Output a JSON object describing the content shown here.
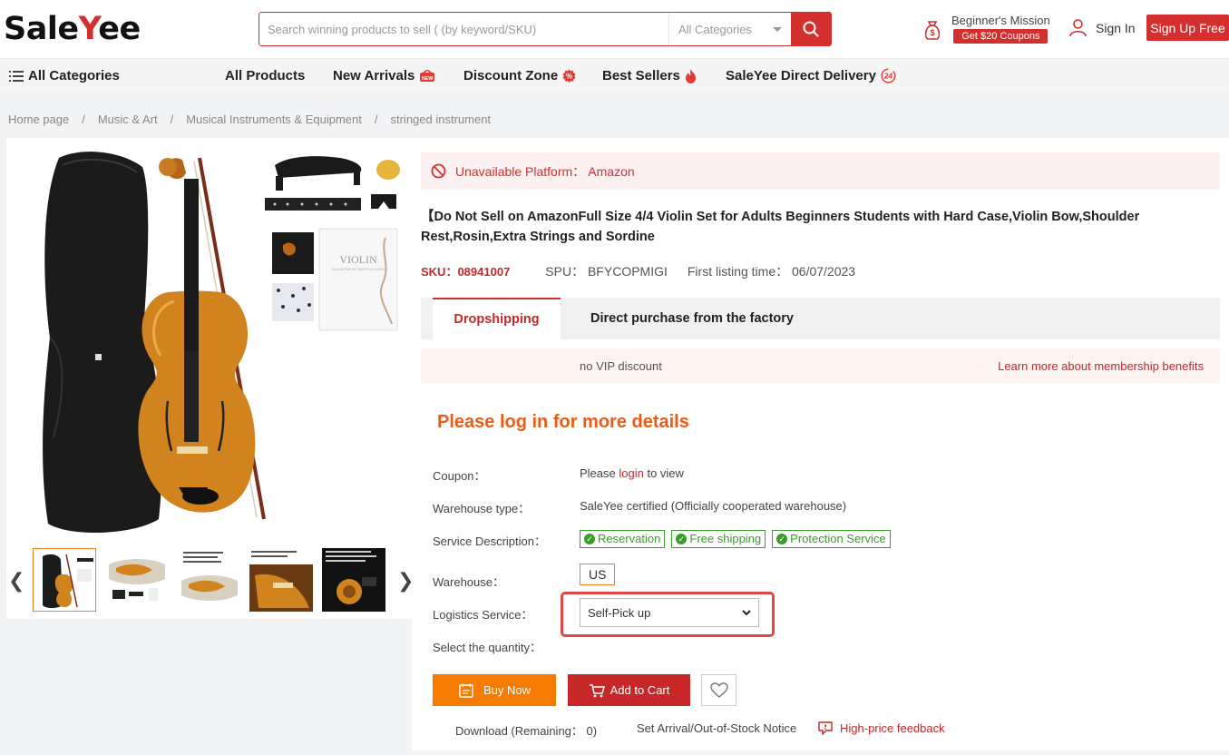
{
  "header": {
    "logo_prefix": "Sale",
    "logo_y": "Y",
    "logo_suffix": "ee",
    "search_placeholder": "Search winning products to sell ( (by keyword/SKU)",
    "category_select": "All Categories",
    "mission_title": "Beginner's Mission",
    "mission_coupon": "Get $20 Coupons",
    "sign_in": "Sign In",
    "sign_up": "Sign Up Free"
  },
  "nav": {
    "all_categories": "All Categories",
    "items": [
      {
        "label": "All Products"
      },
      {
        "label": "New Arrivals",
        "badge": "NEW"
      },
      {
        "label": "Discount Zone"
      },
      {
        "label": "Best Sellers"
      },
      {
        "label": "SaleYee Direct Delivery",
        "badge": "24"
      }
    ]
  },
  "breadcrumb": [
    "Home page",
    "Music & Art",
    "Musical Instruments & Equipment",
    "stringed instrument"
  ],
  "product": {
    "unavailable": "Unavailable Platform： Amazon",
    "title": "【Do Not Sell on AmazonFull Size 4/4 Violin Set for Adults Beginners Students with Hard Case,Violin Bow,Shoulder Rest,Rosin,Extra Strings and Sordine",
    "sku_label": "SKU：",
    "sku": "08941007",
    "spu": "SPU： BFYCOPMIGI",
    "first_listing": "First listing time： 06/07/2023",
    "manual_text": "VIOLIN",
    "manual_sub": "ADJUSTMENT INSTRUCTIONS"
  },
  "tabs": [
    {
      "label": "Dropshipping",
      "active": true
    },
    {
      "label": "Direct purchase from the factory",
      "active": false
    }
  ],
  "vip": {
    "label": "no VIP discount",
    "link": "Learn more about membership benefits"
  },
  "login_message": "Please log in for more details",
  "details": {
    "coupon_label": "Coupon：",
    "coupon_pre": "Please ",
    "coupon_link": "login",
    "coupon_post": " to view",
    "warehouse_type_label": "Warehouse type：",
    "warehouse_type": "SaleYee certified  (Officially cooperated warehouse)",
    "service_label": "Service Description：",
    "services": [
      "Reservation",
      "Free shipping",
      "Protection Service"
    ],
    "warehouse_label": "Warehouse：",
    "warehouse": "US",
    "logistics_label": "Logistics Service：",
    "logistics_value": "Self-Pick up",
    "quantity_label": "Select the quantity："
  },
  "actions": {
    "buy_now": "Buy Now",
    "add_to_cart": "Add to Cart",
    "download": "Download (Remaining： 0)",
    "notice": "Set Arrival/Out-of-Stock Notice",
    "feedback": "High-price feedback"
  },
  "colors": {
    "brand_red": "#d32f2f",
    "orange": "#f57c00",
    "green": "#3a9d2a"
  }
}
